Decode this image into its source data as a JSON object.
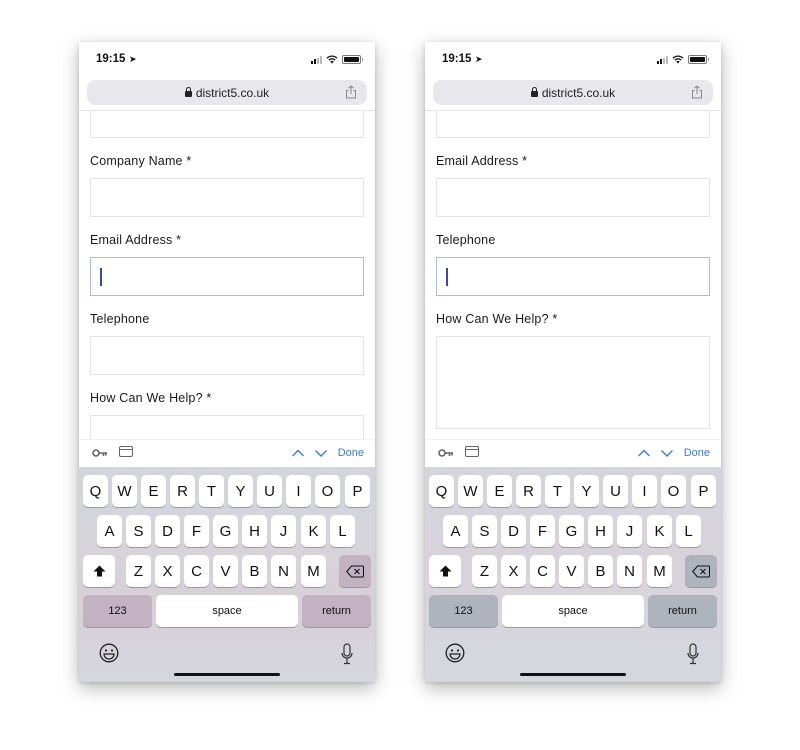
{
  "screens": [
    {
      "status": {
        "time": "19:15"
      },
      "url": "district5.co.uk",
      "fields": [
        {
          "label": "",
          "focused": false
        },
        {
          "label": "Company Name *",
          "focused": false
        },
        {
          "label": "Email Address *",
          "focused": true
        },
        {
          "label": "Telephone",
          "focused": false
        },
        {
          "label": "How Can We Help? *",
          "focused": false
        }
      ],
      "accessory": {
        "done_label": "Done"
      }
    },
    {
      "status": {
        "time": "19:15"
      },
      "url": "district5.co.uk",
      "fields": [
        {
          "label": "",
          "focused": false
        },
        {
          "label": "Email Address *",
          "focused": false
        },
        {
          "label": "Telephone",
          "focused": true
        },
        {
          "label": "How Can We Help? *",
          "focused": false
        }
      ],
      "accessory": {
        "done_label": "Done"
      }
    }
  ],
  "keyboard": {
    "rows": [
      [
        "Q",
        "W",
        "E",
        "R",
        "T",
        "Y",
        "U",
        "I",
        "O",
        "P"
      ],
      [
        "A",
        "S",
        "D",
        "F",
        "G",
        "H",
        "J",
        "K",
        "L"
      ],
      [
        "Z",
        "X",
        "C",
        "V",
        "B",
        "N",
        "M"
      ]
    ],
    "numbers_label": "123",
    "space_label": "space",
    "return_label": "return"
  },
  "icons": {
    "location": "location-arrow-icon",
    "signal": "cellular-signal-icon",
    "wifi": "wifi-icon",
    "battery": "battery-icon",
    "lock": "lock-icon",
    "share": "share-icon",
    "key": "key-icon",
    "card": "credit-card-icon",
    "up": "chevron-up-icon",
    "down": "chevron-down-icon",
    "shift": "shift-icon",
    "backspace": "backspace-icon",
    "emoji": "emoji-icon",
    "mic": "microphone-icon"
  }
}
